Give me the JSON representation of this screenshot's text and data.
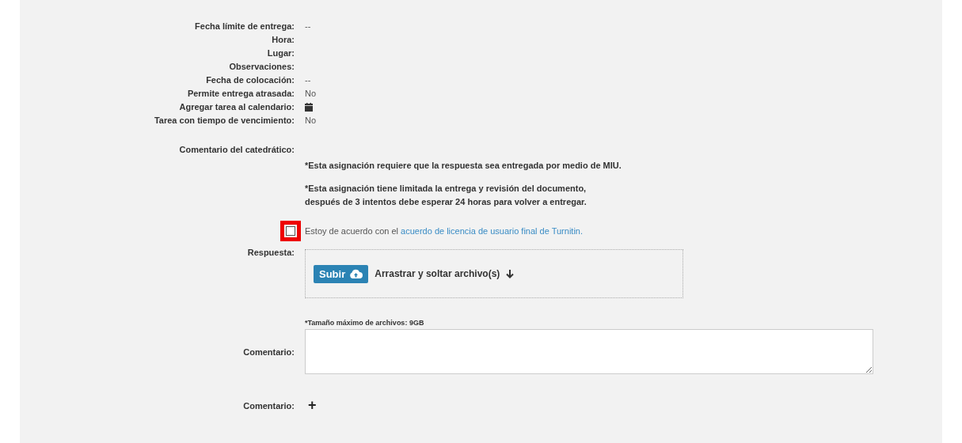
{
  "details": [
    {
      "label": "Fecha límite de entrega:",
      "kind": "text",
      "value": "--"
    },
    {
      "label": "Hora:",
      "kind": "text"
    },
    {
      "label": "Lugar:",
      "kind": "text"
    },
    {
      "label": "Observaciones:",
      "kind": "text"
    },
    {
      "label": "Fecha de colocación:",
      "kind": "text",
      "value": "--"
    },
    {
      "label": "Permite entrega atrasada:",
      "kind": "text",
      "value": "No"
    },
    {
      "label": "Agregar tarea al calendario:",
      "kind": "calendar"
    },
    {
      "label": "Tarea con tiempo de vencimiento:",
      "kind": "text",
      "value": "No"
    }
  ],
  "teacher_comment": {
    "label": "Comentario del catedrático:",
    "notes": [
      "*Esta asignación requiere que la respuesta sea entregada por medio de MIU.",
      "*Esta asignación tiene limitada la entrega y revisión del documento,\ndespués de 3 intentos debe esperar 24 horas para volver a entregar."
    ]
  },
  "agreement": {
    "checked": false,
    "highlighted": true,
    "text": "Estoy de acuerdo con el",
    "link": "acuerdo de licencia de usuario final de Turnitin."
  },
  "answer": {
    "label": "Respuesta:",
    "upload_button": "Subir",
    "drop_text": "Arrastrar y soltar archivo(s)",
    "size_note": "*Tamaño máximo de archivos: 9GB"
  },
  "comment": {
    "label": "Comentario:"
  },
  "add_comment": {
    "label": "Comentario:",
    "icon": "+"
  }
}
